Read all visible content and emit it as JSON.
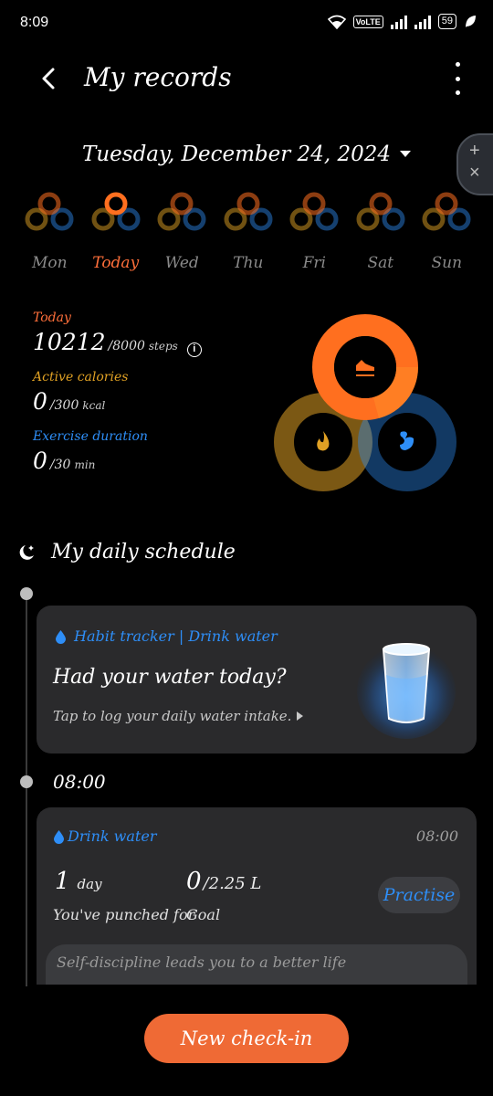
{
  "status_bar": {
    "time": "8:09",
    "volte": "VoLTE",
    "battery": "59"
  },
  "header": {
    "title": "My records"
  },
  "date": {
    "label": "Tuesday, December 24, 2024"
  },
  "week": [
    {
      "label": "Mon",
      "today": false
    },
    {
      "label": "Today",
      "today": true
    },
    {
      "label": "Wed",
      "today": false
    },
    {
      "label": "Thu",
      "today": false
    },
    {
      "label": "Fri",
      "today": false
    },
    {
      "label": "Sat",
      "today": false
    },
    {
      "label": "Sun",
      "today": false
    }
  ],
  "stats": {
    "steps": {
      "label": "Today",
      "value": "10212",
      "target": "/8000",
      "unit": "steps"
    },
    "calories": {
      "label": "Active calories",
      "value": "0",
      "target": "/300",
      "unit": "kcal"
    },
    "exercise": {
      "label": "Exercise duration",
      "value": "0",
      "target": "/30",
      "unit": "min"
    }
  },
  "colors": {
    "steps": "#ff6f1f",
    "calories": "#e0a124",
    "exercise": "#2e8ef7",
    "accent": "#ef6a35"
  },
  "schedule": {
    "title": "My daily schedule",
    "habit": {
      "tag": "Habit tracker | Drink water",
      "title": "Had your water today?",
      "subtitle": "Tap to log your daily water intake."
    },
    "slot_time": "08:00",
    "water": {
      "tag": "Drink water",
      "time": "08:00",
      "days_value": "1",
      "days_unit": "day",
      "days_caption": "You've punched for",
      "goal_value": "0",
      "goal_target": "/2.25 L",
      "goal_caption": "Goal",
      "action": "Practise",
      "motto": "Self-discipline leads you to a better life"
    }
  },
  "footer": {
    "button": "New check-in"
  }
}
